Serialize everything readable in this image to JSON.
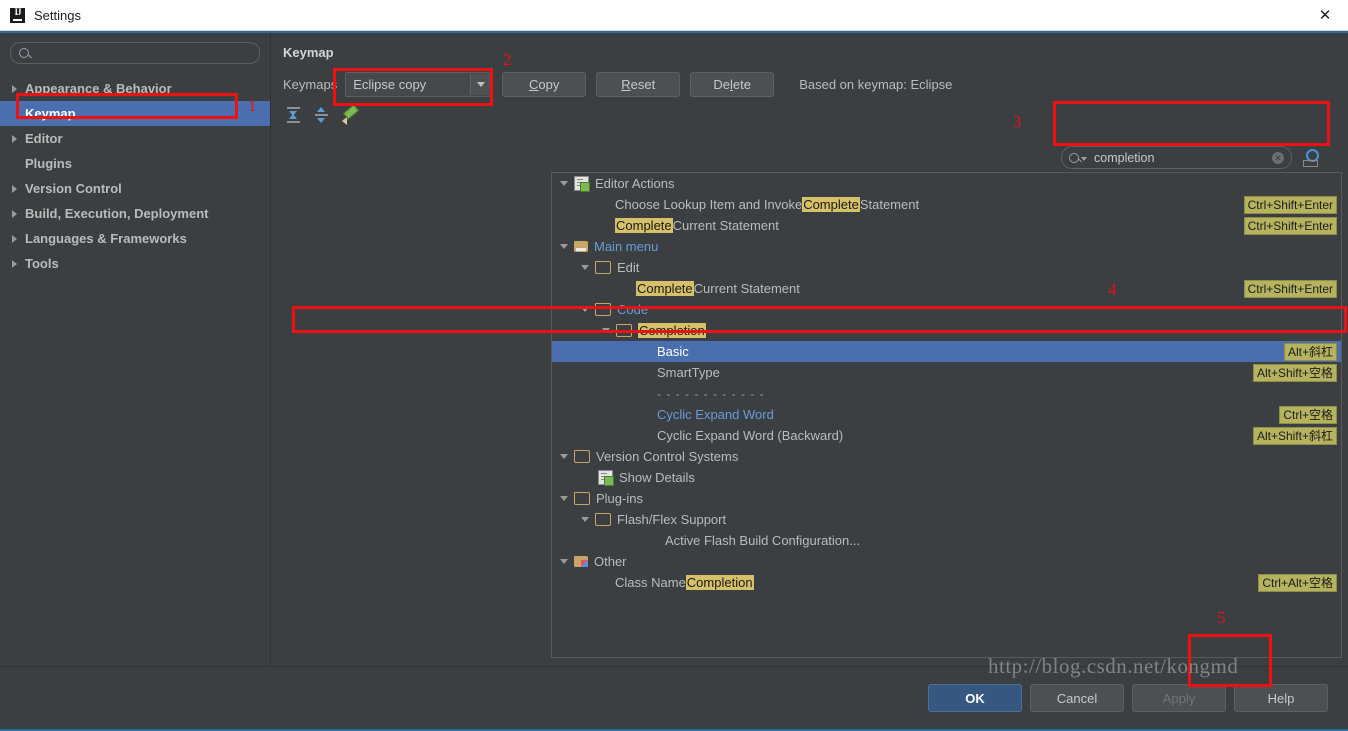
{
  "window": {
    "title": "Settings",
    "logo_icon": "intellij-idea-logo",
    "close_icon": "close-icon"
  },
  "sidebar": {
    "search": {
      "placeholder": "",
      "value": "",
      "icon": "search-icon"
    },
    "items": [
      {
        "label": "Appearance & Behavior",
        "expandable": true,
        "selected": false
      },
      {
        "label": "Keymap",
        "expandable": false,
        "selected": true
      },
      {
        "label": "Editor",
        "expandable": true,
        "selected": false
      },
      {
        "label": "Plugins",
        "expandable": false,
        "selected": false
      },
      {
        "label": "Version Control",
        "expandable": true,
        "selected": false
      },
      {
        "label": "Build, Execution, Deployment",
        "expandable": true,
        "selected": false
      },
      {
        "label": "Languages & Frameworks",
        "expandable": true,
        "selected": false
      },
      {
        "label": "Tools",
        "expandable": true,
        "selected": false
      }
    ]
  },
  "content": {
    "title": "Keymap",
    "keymaps_label": "Keymaps",
    "keymap_selected": "Eclipse copy",
    "buttons": {
      "copy": "Copy",
      "reset": "Reset",
      "delete": "Delete"
    },
    "based_on": "Based on keymap: Eclipse",
    "toolbar_icons": [
      "expand-all-icon",
      "collapse-all-icon",
      "edit-shortcut-icon"
    ],
    "find": {
      "value": "completion",
      "clear_icon": "clear-icon",
      "search_icon": "search-icon",
      "filter_icon": "find-by-shortcut-icon"
    }
  },
  "tree": [
    {
      "indent": 0,
      "arrow": "down",
      "icon": "editor-actions-icon",
      "label": "Editor Actions",
      "style": "plain",
      "shortcut": ""
    },
    {
      "indent": 3,
      "arrow": "none",
      "icon": "",
      "label": "Choose Lookup Item and Invoke ",
      "highlight": "Complete",
      "label_after": " Statement",
      "style": "plain",
      "shortcut": "Ctrl+Shift+Enter"
    },
    {
      "indent": 3,
      "arrow": "none",
      "icon": "",
      "label": "",
      "highlight": "Complete",
      "label_after": " Current Statement",
      "style": "plain",
      "shortcut": "Ctrl+Shift+Enter"
    },
    {
      "indent": 0,
      "arrow": "down",
      "icon": "main-menu-folder-icon",
      "label": "Main menu",
      "style": "blue",
      "shortcut": ""
    },
    {
      "indent": 1,
      "arrow": "down",
      "icon": "folder-icon",
      "label": "Edit",
      "style": "plain",
      "shortcut": ""
    },
    {
      "indent": 3,
      "arrow": "none",
      "icon": "",
      "label": "",
      "highlight": "Complete",
      "label_after": " Current Statement",
      "style": "plain",
      "shortcut": "Ctrl+Shift+Enter"
    },
    {
      "indent": 1,
      "arrow": "down",
      "icon": "folder-icon",
      "label": "Code",
      "style": "blue",
      "shortcut": ""
    },
    {
      "indent": 2,
      "arrow": "down",
      "icon": "folder-icon",
      "label": "",
      "highlight": "Completion",
      "label_after": "",
      "style": "plain",
      "shortcut": ""
    },
    {
      "indent": 4,
      "arrow": "none",
      "icon": "",
      "label": "Basic",
      "style": "white",
      "selected": true,
      "shortcut": "Alt+斜杠"
    },
    {
      "indent": 4,
      "arrow": "none",
      "icon": "",
      "label": "SmartType",
      "style": "plain",
      "shortcut": "Alt+Shift+空格"
    },
    {
      "indent": 4,
      "arrow": "none",
      "icon": "",
      "label": "- - - - - - - - - - - -",
      "style": "dashes",
      "shortcut": ""
    },
    {
      "indent": 4,
      "arrow": "none",
      "icon": "",
      "label": "Cyclic Expand Word",
      "style": "blue",
      "shortcut": "Ctrl+空格"
    },
    {
      "indent": 4,
      "arrow": "none",
      "icon": "",
      "label": "Cyclic Expand Word (Backward)",
      "style": "plain",
      "shortcut": "Alt+Shift+斜杠"
    },
    {
      "indent": 0,
      "arrow": "down",
      "icon": "folder-icon",
      "label": "Version Control Systems",
      "style": "plain",
      "shortcut": ""
    },
    {
      "indent": 1,
      "arrow": "none",
      "icon": "show-details-icon",
      "label": "Show Details",
      "style": "plain",
      "shortcut": ""
    },
    {
      "indent": 0,
      "arrow": "down",
      "icon": "folder-icon",
      "label": "Plug-ins",
      "style": "plain",
      "shortcut": ""
    },
    {
      "indent": 1,
      "arrow": "down",
      "icon": "folder-icon",
      "label": "Flash/Flex Support",
      "style": "plain",
      "shortcut": ""
    },
    {
      "indent": 3,
      "arrow": "none",
      "icon": "",
      "label": "Active Flash Build Configuration...",
      "style": "plain",
      "shortcut": ""
    },
    {
      "indent": 0,
      "arrow": "down",
      "icon": "other-folder-icon",
      "label": "Other",
      "style": "plain",
      "shortcut": ""
    },
    {
      "indent": 2,
      "arrow": "none",
      "icon": "",
      "label": "Class Name ",
      "highlight": "Completion",
      "label_after": "",
      "style": "plain",
      "shortcut": "Ctrl+Alt+空格"
    }
  ],
  "footer": {
    "ok": "OK",
    "cancel": "Cancel",
    "apply": "Apply",
    "help": "Help"
  },
  "annotations": {
    "numbers": [
      "1",
      "2",
      "3",
      "4",
      "5"
    ],
    "color": "#ee1111"
  },
  "watermark": {
    "text": "http://blog.csdn.net/kongmd"
  }
}
